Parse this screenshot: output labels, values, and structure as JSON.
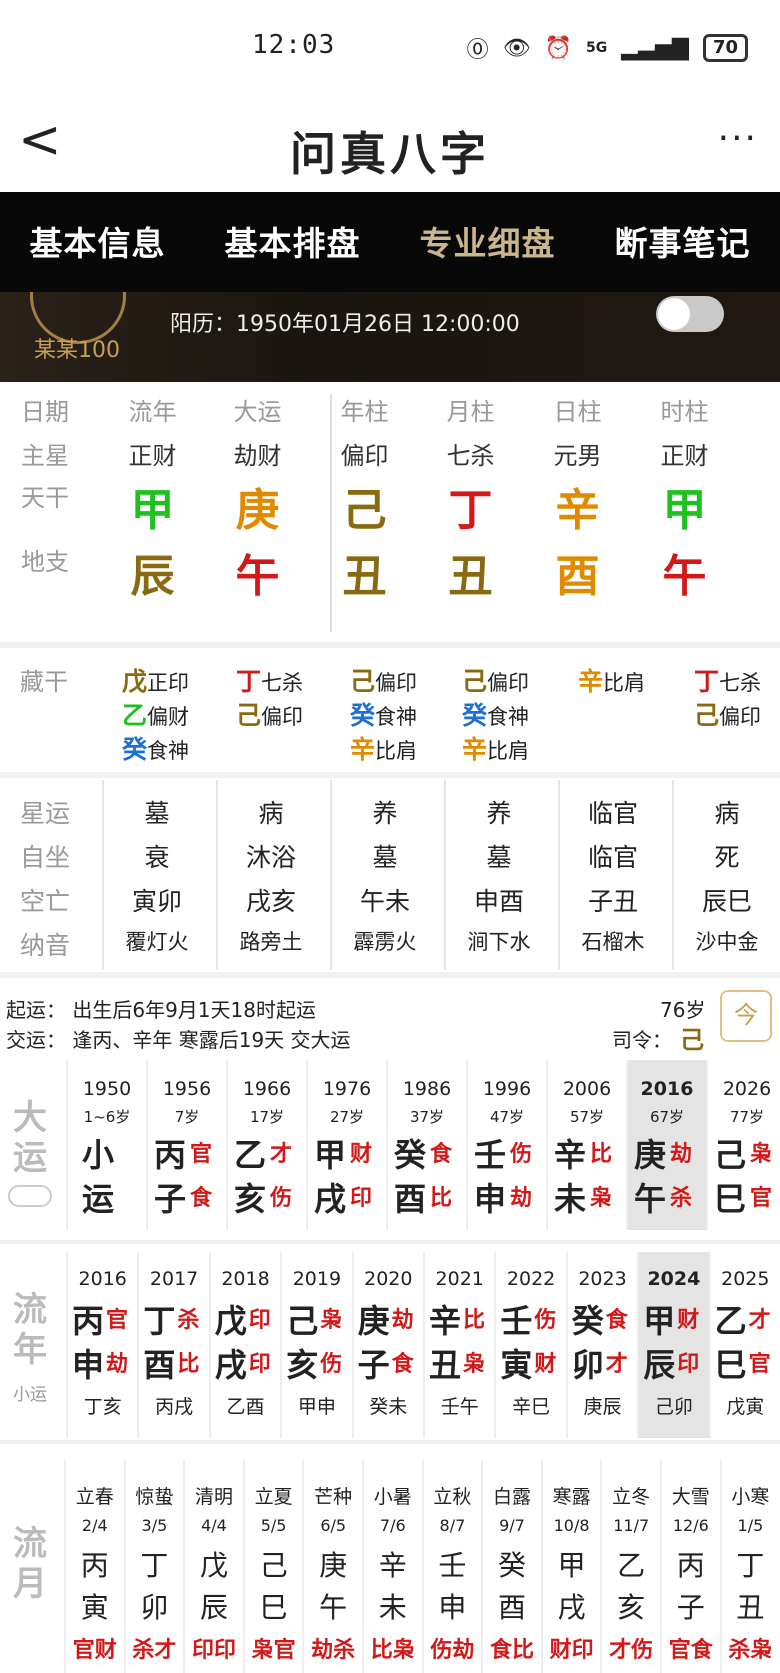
{
  "status": {
    "time": "12:03",
    "battery": "70",
    "signal": "5G"
  },
  "header": {
    "title": "问真八字",
    "back": "<",
    "more": "···"
  },
  "tabs": [
    "基本信息",
    "基本排盘",
    "专业细盘",
    "断事笔记"
  ],
  "profile": {
    "name": "某某100",
    "solar": "阳历：1950年01月26日 12:00:00"
  },
  "pillars": {
    "row_labels": [
      "日期",
      "主星",
      "天干",
      "地支"
    ],
    "columns": [
      {
        "head": "流年",
        "star": "正财",
        "gan": "甲",
        "gan_color": "#1ec21e",
        "zhi": "辰",
        "zhi_color": "#8a6a10"
      },
      {
        "head": "大运",
        "star": "劫财",
        "gan": "庚",
        "gan_color": "#e08a00",
        "zhi": "午",
        "zhi_color": "#d21818"
      },
      {
        "head": "年柱",
        "star": "偏印",
        "gan": "己",
        "gan_color": "#8a6a10",
        "zhi": "丑",
        "zhi_color": "#8a6a10"
      },
      {
        "head": "月柱",
        "star": "七杀",
        "gan": "丁",
        "gan_color": "#d21818",
        "zhi": "丑",
        "zhi_color": "#8a6a10"
      },
      {
        "head": "日柱",
        "star": "元男",
        "gan": "辛",
        "gan_color": "#e08a00",
        "zhi": "酉",
        "zhi_color": "#e08a00"
      },
      {
        "head": "时柱",
        "star": "正财",
        "gan": "甲",
        "gan_color": "#1ec21e",
        "zhi": "午",
        "zhi_color": "#d21818"
      }
    ]
  },
  "canggan": {
    "label": "藏干",
    "columns": [
      [
        {
          "c": "戊",
          "col": "#8a6a10",
          "t": "正印"
        },
        {
          "c": "乙",
          "col": "#1ec21e",
          "t": "偏财"
        },
        {
          "c": "癸",
          "col": "#1a70d8",
          "t": "食神"
        }
      ],
      [
        {
          "c": "丁",
          "col": "#d21818",
          "t": "七杀"
        },
        {
          "c": "己",
          "col": "#8a6a10",
          "t": "偏印"
        }
      ],
      [
        {
          "c": "己",
          "col": "#8a6a10",
          "t": "偏印"
        },
        {
          "c": "癸",
          "col": "#1a70d8",
          "t": "食神"
        },
        {
          "c": "辛",
          "col": "#e08a00",
          "t": "比肩"
        }
      ],
      [
        {
          "c": "己",
          "col": "#8a6a10",
          "t": "偏印"
        },
        {
          "c": "癸",
          "col": "#1a70d8",
          "t": "食神"
        },
        {
          "c": "辛",
          "col": "#e08a00",
          "t": "比肩"
        }
      ],
      [
        {
          "c": "辛",
          "col": "#e08a00",
          "t": "比肩"
        }
      ],
      [
        {
          "c": "丁",
          "col": "#d21818",
          "t": "七杀"
        },
        {
          "c": "己",
          "col": "#8a6a10",
          "t": "偏印"
        }
      ]
    ]
  },
  "details": {
    "labels": [
      "星运",
      "自坐",
      "空亡",
      "纳音"
    ],
    "columns": [
      [
        "墓",
        "衰",
        "寅卯",
        "覆灯火"
      ],
      [
        "病",
        "沐浴",
        "戌亥",
        "路旁土"
      ],
      [
        "养",
        "墓",
        "午未",
        "霹雳火"
      ],
      [
        "养",
        "墓",
        "申酉",
        "涧下水"
      ],
      [
        "临官",
        "临官",
        "子丑",
        "石榴木"
      ],
      [
        "病",
        "死",
        "辰巳",
        "沙中金"
      ]
    ]
  },
  "yun_info": {
    "line1": "起运：  出生后6年9月1天18时起运",
    "line2": "交运：  逢丙、辛年 寒露后19天 交大运",
    "age": "76岁",
    "siling_label": "司令：",
    "siling": "己",
    "today_btn": "今"
  },
  "dayun": {
    "label": "大运",
    "items": [
      {
        "year": "1950",
        "age": "1~6岁",
        "g": "小",
        "z": "运",
        "gs": "",
        "zs": ""
      },
      {
        "year": "1956",
        "age": "7岁",
        "g": "丙",
        "z": "子",
        "gs": "官",
        "zs": "食"
      },
      {
        "year": "1966",
        "age": "17岁",
        "g": "乙",
        "z": "亥",
        "gs": "才",
        "zs": "伤"
      },
      {
        "year": "1976",
        "age": "27岁",
        "g": "甲",
        "z": "戌",
        "gs": "财",
        "zs": "印"
      },
      {
        "year": "1986",
        "age": "37岁",
        "g": "癸",
        "z": "酉",
        "gs": "食",
        "zs": "比"
      },
      {
        "year": "1996",
        "age": "47岁",
        "g": "壬",
        "z": "申",
        "gs": "伤",
        "zs": "劫"
      },
      {
        "year": "2006",
        "age": "57岁",
        "g": "辛",
        "z": "未",
        "gs": "比",
        "zs": "枭"
      },
      {
        "year": "2016",
        "age": "67岁",
        "g": "庚",
        "z": "午",
        "gs": "劫",
        "zs": "杀"
      },
      {
        "year": "2026",
        "age": "77岁",
        "g": "己",
        "z": "巳",
        "gs": "枭",
        "zs": "官"
      }
    ]
  },
  "liunian": {
    "label": "流年",
    "sub": "小运",
    "items": [
      {
        "year": "2016",
        "g": "丙",
        "z": "申",
        "gs": "官",
        "zs": "劫",
        "x": "丁亥"
      },
      {
        "year": "2017",
        "g": "丁",
        "z": "酉",
        "gs": "杀",
        "zs": "比",
        "x": "丙戌"
      },
      {
        "year": "2018",
        "g": "戊",
        "z": "戌",
        "gs": "印",
        "zs": "印",
        "x": "乙酉"
      },
      {
        "year": "2019",
        "g": "己",
        "z": "亥",
        "gs": "枭",
        "zs": "伤",
        "x": "甲申"
      },
      {
        "year": "2020",
        "g": "庚",
        "z": "子",
        "gs": "劫",
        "zs": "食",
        "x": "癸未"
      },
      {
        "year": "2021",
        "g": "辛",
        "z": "丑",
        "gs": "比",
        "zs": "枭",
        "x": "壬午"
      },
      {
        "year": "2022",
        "g": "壬",
        "z": "寅",
        "gs": "伤",
        "zs": "财",
        "x": "辛巳"
      },
      {
        "year": "2023",
        "g": "癸",
        "z": "卯",
        "gs": "食",
        "zs": "才",
        "x": "庚辰"
      },
      {
        "year": "2024",
        "g": "甲",
        "z": "辰",
        "gs": "财",
        "zs": "印",
        "x": "己卯"
      },
      {
        "year": "2025",
        "g": "乙",
        "z": "巳",
        "gs": "才",
        "zs": "官",
        "x": "戊寅"
      }
    ]
  },
  "liuyue": {
    "label": "流月",
    "items": [
      {
        "term": "立春",
        "date": "2/4",
        "g": "丙",
        "z": "寅",
        "ss": "官财"
      },
      {
        "term": "惊蛰",
        "date": "3/5",
        "g": "丁",
        "z": "卯",
        "ss": "杀才"
      },
      {
        "term": "清明",
        "date": "4/4",
        "g": "戊",
        "z": "辰",
        "ss": "印印"
      },
      {
        "term": "立夏",
        "date": "5/5",
        "g": "己",
        "z": "巳",
        "ss": "枭官"
      },
      {
        "term": "芒种",
        "date": "6/5",
        "g": "庚",
        "z": "午",
        "ss": "劫杀"
      },
      {
        "term": "小暑",
        "date": "7/6",
        "g": "辛",
        "z": "未",
        "ss": "比枭"
      },
      {
        "term": "立秋",
        "date": "8/7",
        "g": "壬",
        "z": "申",
        "ss": "伤劫"
      },
      {
        "term": "白露",
        "date": "9/7",
        "g": "癸",
        "z": "酉",
        "ss": "食比"
      },
      {
        "term": "寒露",
        "date": "10/8",
        "g": "甲",
        "z": "戌",
        "ss": "财印"
      },
      {
        "term": "立冬",
        "date": "11/7",
        "g": "乙",
        "z": "亥",
        "ss": "才伤"
      },
      {
        "term": "大雪",
        "date": "12/6",
        "g": "丙",
        "z": "子",
        "ss": "官食"
      },
      {
        "term": "小寒",
        "date": "1/5",
        "g": "丁",
        "z": "丑",
        "ss": "杀枭"
      }
    ]
  }
}
